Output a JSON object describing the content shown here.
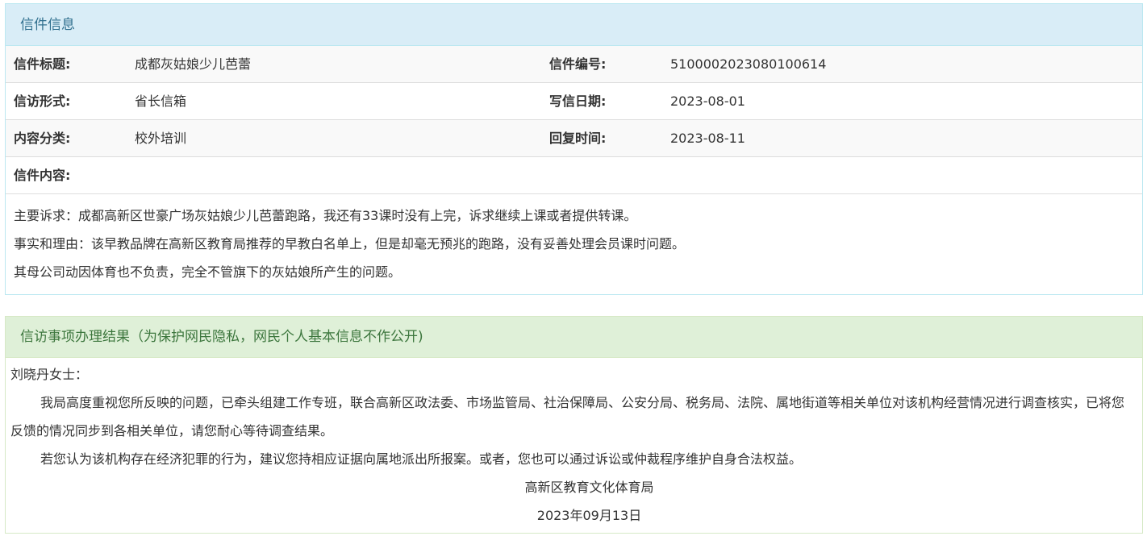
{
  "letter_panel": {
    "heading": "信件信息",
    "rows": [
      {
        "label1": "信件标题:",
        "value1": "成都灰姑娘少儿芭蕾",
        "label2": "信件编号:",
        "value2": "5100002023080100614"
      },
      {
        "label1": "信访形式:",
        "value1": "省长信箱",
        "label2": "写信日期:",
        "value2": "2023-08-01"
      },
      {
        "label1": "内容分类:",
        "value1": "校外培训",
        "label2": "回复时间:",
        "value2": "2023-08-11"
      }
    ],
    "content_label": "信件内容:",
    "content_lines": [
      "主要诉求：成都高新区世豪广场灰姑娘少儿芭蕾跑路，我还有33课时没有上完，诉求继续上课或者提供转课。",
      "事实和理由：该早教品牌在高新区教育局推荐的早教白名单上，但是却毫无预兆的跑路，没有妥善处理会员课时问题。",
      "其母公司动因体育也不负责，完全不管旗下的灰姑娘所产生的问题。"
    ]
  },
  "result_panel": {
    "heading": "信访事项办理结果（为保护网民隐私，网民个人基本信息不作公开)",
    "salutation": "刘晓丹女士：",
    "paragraph1": "我局高度重视您所反映的问题，已牵头组建工作专班，联合高新区政法委、市场监管局、社治保障局、公安分局、税务局、法院、属地街道等相关单位对该机构经营情况进行调查核实，已将您反馈的情况同步到各相关单位，请您耐心等待调查结果。",
    "paragraph2": "若您认为该机构存在经济犯罪的行为，建议您持相应证据向属地派出所报案。或者，您也可以通过诉讼或仲裁程序维护自身合法权益。",
    "signature": "高新区教育文化体育局",
    "date": "2023年09月13日"
  }
}
